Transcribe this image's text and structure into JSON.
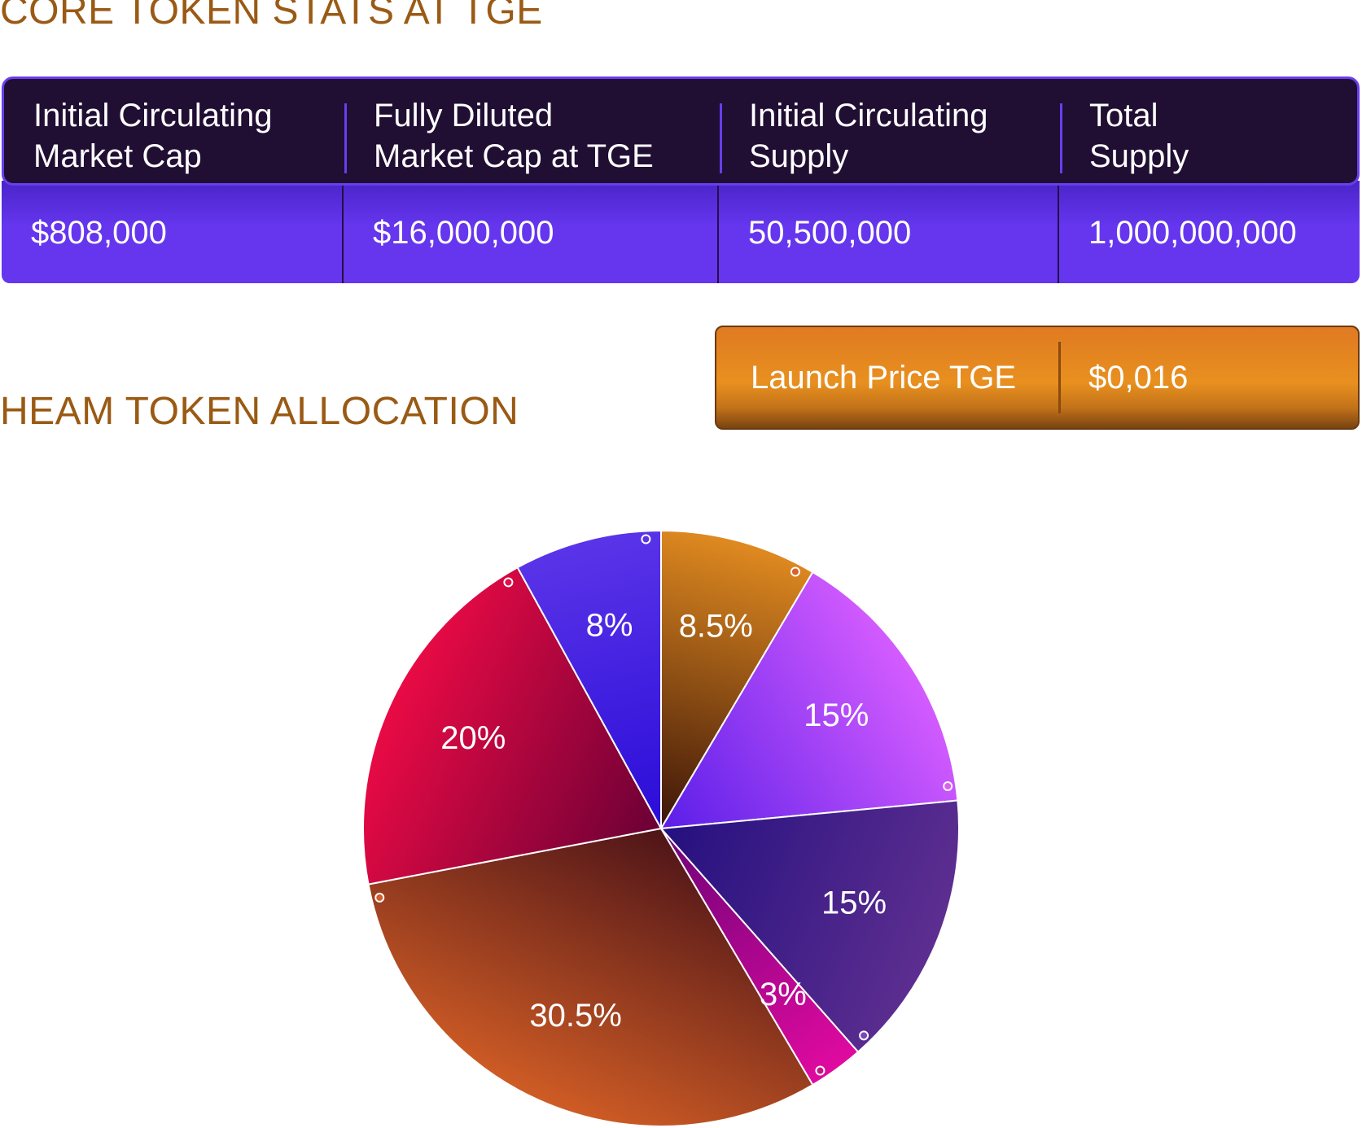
{
  "core_stats": {
    "title": "CORE TOKEN STATS AT TGE",
    "columns": [
      {
        "label_line1": "Initial Circulating",
        "label_line2": "Market Cap",
        "value": "$808,000"
      },
      {
        "label_line1": "Fully Diluted",
        "label_line2": "Market Cap at TGE",
        "value": "$16,000,000"
      },
      {
        "label_line1": "Initial Circulating",
        "label_line2": "Supply",
        "value": "50,500,000"
      },
      {
        "label_line1": "Total",
        "label_line2": "Supply",
        "value": "1,000,000,000"
      }
    ],
    "launch_price": {
      "label": "Launch Price TGE",
      "value": "$0,016"
    }
  },
  "allocation": {
    "title": "HEAM TOKEN ALLOCATION"
  },
  "chart_data": {
    "type": "pie",
    "title": "HEAM TOKEN ALLOCATION",
    "start": "12 o'clock",
    "direction": "clockwise",
    "slices": [
      {
        "label": "8.5%",
        "value": 8.5,
        "colors": [
          "#e08a20",
          "#3b1408"
        ],
        "marker": "#d9612a"
      },
      {
        "label": "15%",
        "value": 15,
        "colors": [
          "#d45cff",
          "#5a1ee8"
        ],
        "marker": "#d860f5"
      },
      {
        "label": "15%",
        "value": 15,
        "colors": [
          "#5d2e90",
          "#24107f"
        ],
        "marker": "#7a45c0"
      },
      {
        "label": "3%",
        "value": 3,
        "colors": [
          "#e00aa0",
          "#6e0278"
        ],
        "marker": "#c21488"
      },
      {
        "label": "30.5%",
        "value": 30.5,
        "colors": [
          "#cf5c25",
          "#4e1418"
        ],
        "marker": "#d65a2a"
      },
      {
        "label": "20%",
        "value": 20,
        "colors": [
          "#ea0a45",
          "#6a0035"
        ],
        "marker": "#e0104a"
      },
      {
        "label": "8%",
        "value": 8,
        "colors": [
          "#5a34e8",
          "#2a0cd8"
        ],
        "marker": "#5a36e0"
      }
    ]
  }
}
